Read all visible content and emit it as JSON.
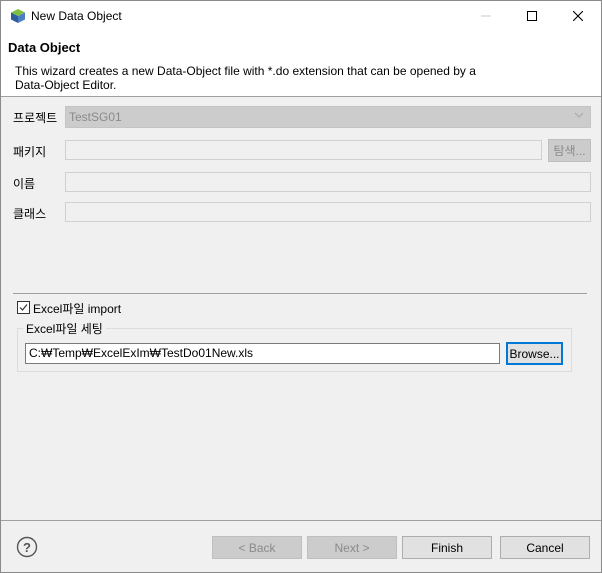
{
  "window": {
    "title": "New Data Object",
    "icon": "eclipse-cube-icon",
    "controls": {
      "minimize": "—",
      "maximize": "☐",
      "close": "✕"
    }
  },
  "header": {
    "title": "Data Object",
    "description": "This wizard creates a new Data-Object file with *.do extension that can be opened by a Data-Object Editor."
  },
  "form": {
    "project": {
      "label": "프로젝트",
      "value": "TestSG01",
      "disabled": true
    },
    "package": {
      "label": "패키지",
      "value": "",
      "browse_label": "탐색..."
    },
    "name": {
      "label": "이름",
      "value": ""
    },
    "class": {
      "label": "클래스",
      "value": ""
    }
  },
  "excel": {
    "import_checkbox_label": "Excel파일 import",
    "import_checked": true,
    "group_label": "Excel파일 세팅",
    "file_path": "C:₩Temp₩ExcelExIm₩TestDo01New.xls",
    "browse_label": "Browse..."
  },
  "footer": {
    "help_icon": "help-icon",
    "back_label": "< Back",
    "next_label": "Next >",
    "finish_label": "Finish",
    "cancel_label": "Cancel"
  }
}
